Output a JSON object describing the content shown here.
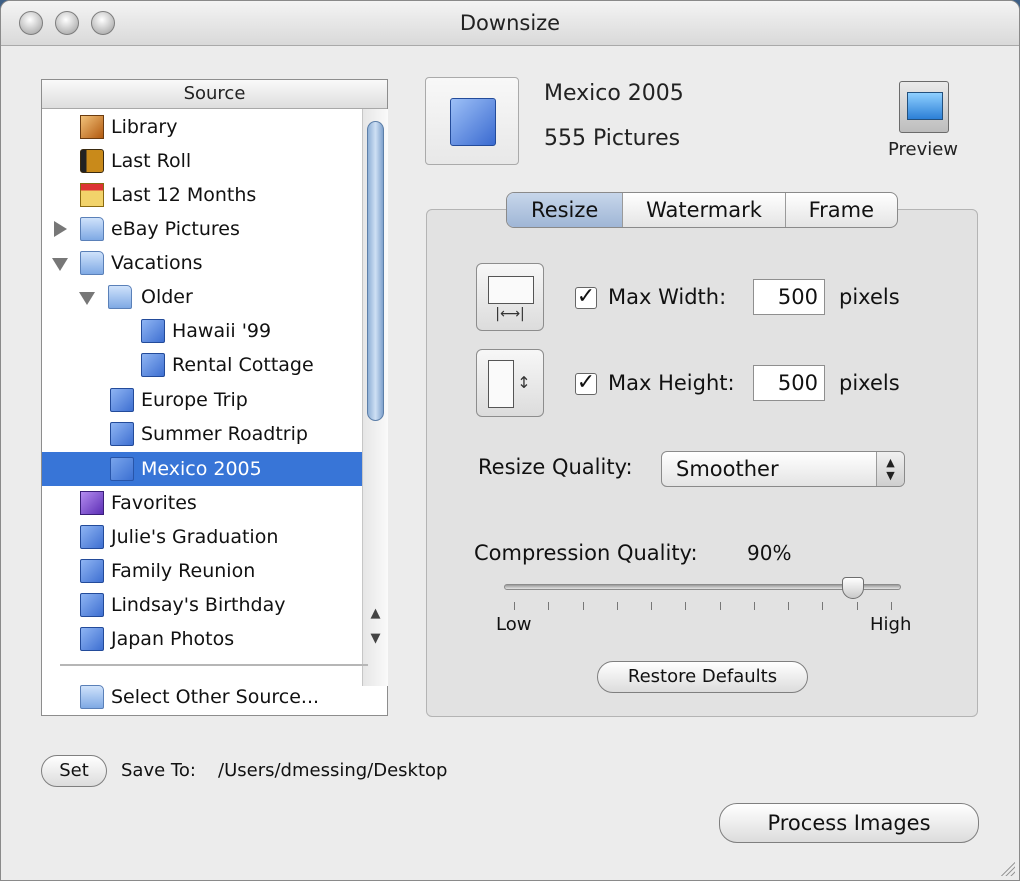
{
  "window": {
    "title": "Downsize"
  },
  "source": {
    "header": "Source",
    "items": [
      {
        "label": "Library",
        "icon": "library-icon"
      },
      {
        "label": "Last Roll",
        "icon": "film-roll-icon"
      },
      {
        "label": "Last 12 Months",
        "icon": "calendar-icon"
      },
      {
        "label": "eBay Pictures",
        "icon": "folder-icon"
      },
      {
        "label": "Vacations",
        "icon": "folder-icon"
      },
      {
        "label": "Older",
        "icon": "folder-icon"
      },
      {
        "label": "Hawaii '99",
        "icon": "album-icon"
      },
      {
        "label": "Rental Cottage",
        "icon": "album-icon"
      },
      {
        "label": "Europe Trip",
        "icon": "album-icon"
      },
      {
        "label": "Summer Roadtrip",
        "icon": "album-icon"
      },
      {
        "label": "Mexico 2005",
        "icon": "album-icon",
        "selected": true
      },
      {
        "label": "Favorites",
        "icon": "smart-album-icon"
      },
      {
        "label": "Julie's Graduation",
        "icon": "album-icon"
      },
      {
        "label": "Family Reunion",
        "icon": "album-icon"
      },
      {
        "label": "Lindsay's Birthday",
        "icon": "album-icon"
      },
      {
        "label": "Japan Photos",
        "icon": "album-icon"
      }
    ],
    "other_source": "Select Other Source..."
  },
  "album": {
    "name": "Mexico 2005",
    "count": "555 Pictures"
  },
  "preview": {
    "label": "Preview"
  },
  "tabs": [
    "Resize",
    "Watermark",
    "Frame"
  ],
  "resize": {
    "max_width": {
      "label": "Max Width:",
      "value": "500",
      "unit": "pixels",
      "checked": true
    },
    "max_height": {
      "label": "Max Height:",
      "value": "500",
      "unit": "pixels",
      "checked": true
    },
    "quality": {
      "label": "Resize Quality:",
      "selected": "Smoother"
    },
    "compression": {
      "label": "Compression Quality:",
      "value": "90%",
      "level": 0.9,
      "min_label": "Low",
      "max_label": "High"
    },
    "restore_label": "Restore Defaults"
  },
  "save": {
    "set_label": "Set",
    "label": "Save To:",
    "path": "/Users/dmessing/Desktop"
  },
  "process_label": "Process Images",
  "colors": {
    "selection": "#3875d7",
    "active_tab": "#a9bfdc"
  }
}
